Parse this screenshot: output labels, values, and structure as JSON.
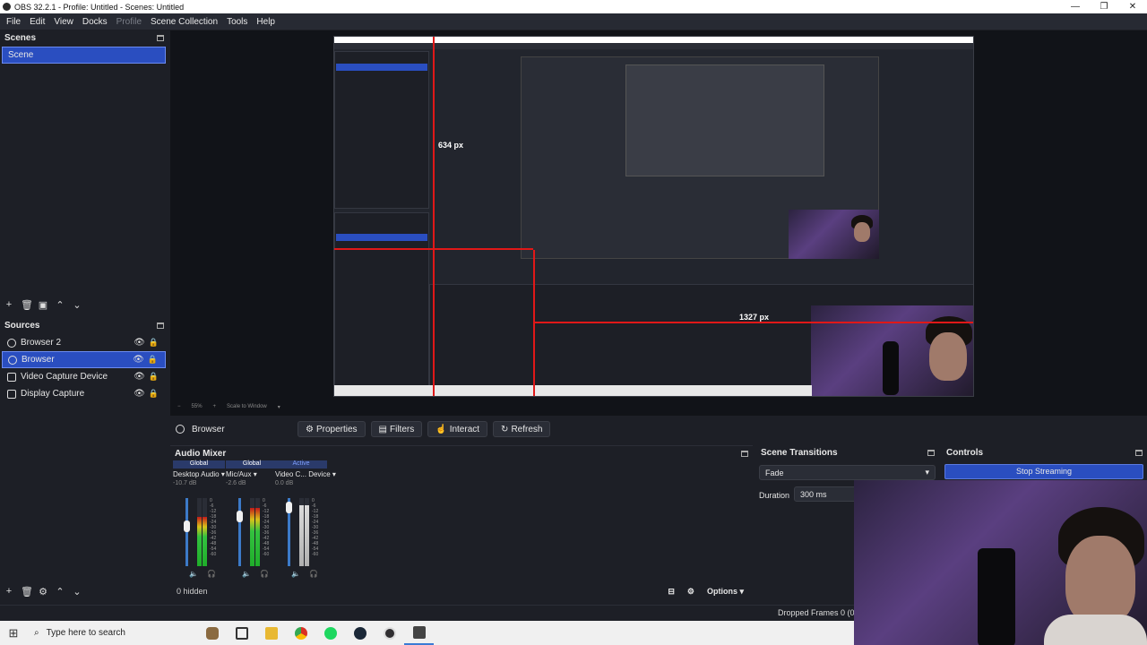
{
  "window": {
    "title": "OBS 32.2.1 - Profile: Untitled - Scenes: Untitled",
    "controls": [
      "—",
      "❐",
      "✕"
    ]
  },
  "menu": [
    {
      "label": "File",
      "dim": false
    },
    {
      "label": "Edit",
      "dim": false
    },
    {
      "label": "View",
      "dim": false
    },
    {
      "label": "Docks",
      "dim": false
    },
    {
      "label": "Profile",
      "dim": true
    },
    {
      "label": "Scene Collection",
      "dim": false
    },
    {
      "label": "Tools",
      "dim": false
    },
    {
      "label": "Help",
      "dim": false
    }
  ],
  "scenes": {
    "title": "Scenes",
    "items": [
      "Scene"
    ],
    "selected": 0
  },
  "sources": {
    "title": "Sources",
    "items": [
      {
        "label": "Browser 2",
        "icon": "globe-icon"
      },
      {
        "label": "Browser",
        "icon": "globe-icon",
        "selected": true
      },
      {
        "label": "Video Capture Device",
        "icon": "camera-icon"
      },
      {
        "label": "Display Capture",
        "icon": "monitor-icon"
      }
    ]
  },
  "preview": {
    "label_height": "634 px",
    "label_width": "1327 px",
    "zoom": "55%",
    "scale_mode": "Scale to Window"
  },
  "source_toolbar": {
    "source_name": "Browser",
    "properties": "Properties",
    "filters": "Filters",
    "interact": "Interact",
    "refresh": "Refresh"
  },
  "mixer": {
    "title": "Audio Mixer",
    "channels": [
      {
        "tag": "Global",
        "name": "Desktop Audio",
        "db": "-10.7 dB",
        "level": 0.72,
        "fader": 0.65,
        "active": false
      },
      {
        "tag": "Global",
        "name": "Mic/Aux",
        "db": "-2.6 dB",
        "level": 0.85,
        "fader": 0.8,
        "active": false
      },
      {
        "tag": "Active",
        "name": "Video C... Device",
        "db": "0.0 dB",
        "level": 0.9,
        "fader": 0.95,
        "active": true
      }
    ],
    "scale_labels": [
      "0",
      "-6",
      "-12",
      "-18",
      "-24",
      "-30",
      "-36",
      "-42",
      "-48",
      "-54",
      "-60"
    ],
    "hidden_label": "0 hidden",
    "options_label": "Options"
  },
  "transitions": {
    "title": "Scene Transitions",
    "type": "Fade",
    "duration_label": "Duration",
    "duration_value": "300 ms"
  },
  "controls": {
    "title": "Controls",
    "stop_streaming": "Stop Streaming"
  },
  "status": {
    "dropped_frames": "Dropped Frames 0 (0."
  },
  "taskbar": {
    "search_placeholder": "Type here to search"
  }
}
